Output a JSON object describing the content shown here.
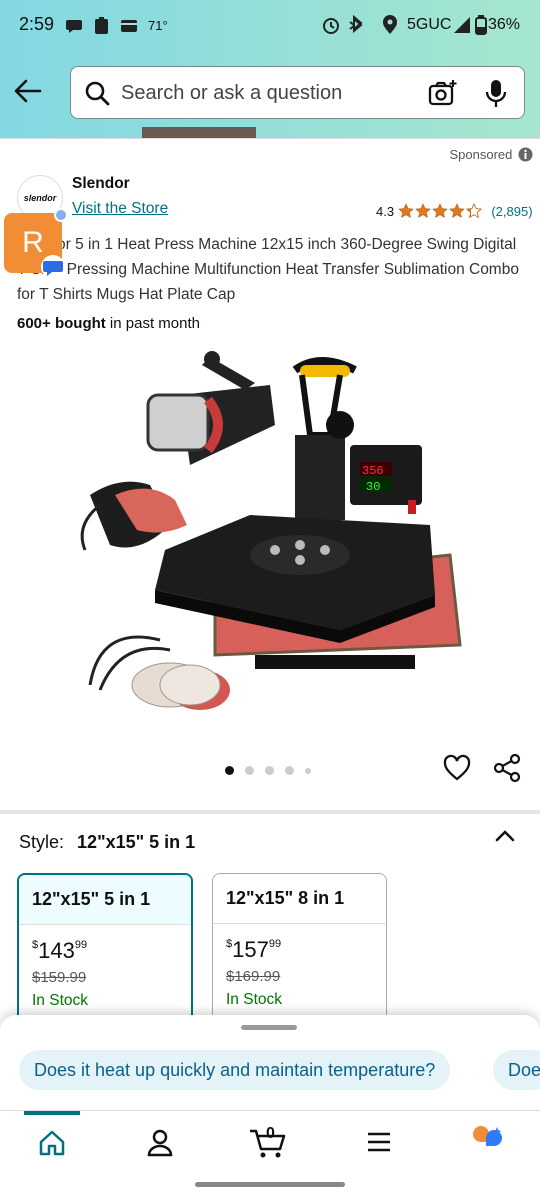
{
  "status_bar": {
    "time": "2:59",
    "temperature": "71°",
    "network": "5GUC",
    "battery": "36%"
  },
  "search": {
    "placeholder": "Search or ask a question"
  },
  "product": {
    "sponsored_label": "Sponsored",
    "brand_logo_text": "slendor",
    "brand_name": "Slendor",
    "visit_store": "Visit the Store",
    "rating": "4.3",
    "rating_value": 4.3,
    "review_count": "(2,895)",
    "title": "or 5 in 1 Heat Press Machine 12x15 inch 360-Degree Swing Digital T Shirt Pressing Machine Multifunction Heat Transfer Sublimation Combo for T Shirts Mugs Hat Plate Cap",
    "bought_bold": "600+ bought",
    "bought_rest": " in past month",
    "display_temp": "356",
    "display_time": "30",
    "image_count": 5,
    "active_image_index": 0
  },
  "floating_avatar": {
    "letter": "R"
  },
  "style": {
    "label": "Style:",
    "selected": "12\"x15\" 5 in 1",
    "options": [
      {
        "name": "12\"x15\" 5 in 1",
        "dollar": "$",
        "whole": "143",
        "cents": "99",
        "list_price": "$159.99",
        "availability": "In Stock"
      },
      {
        "name": "12\"x15\" 8 in 1",
        "dollar": "$",
        "whole": "157",
        "cents": "99",
        "list_price": "$169.99",
        "availability": "In Stock"
      }
    ]
  },
  "questions": [
    "Does it heat up quickly and maintain temperature?",
    "Doe"
  ],
  "nav": {
    "cart_count": "0"
  },
  "colors": {
    "header_start": "#82d8e3",
    "header_end": "#a6e6ce",
    "link": "#007185",
    "star": "#de7921",
    "in_stock": "#007600",
    "avatar_orange": "#f08d35"
  }
}
